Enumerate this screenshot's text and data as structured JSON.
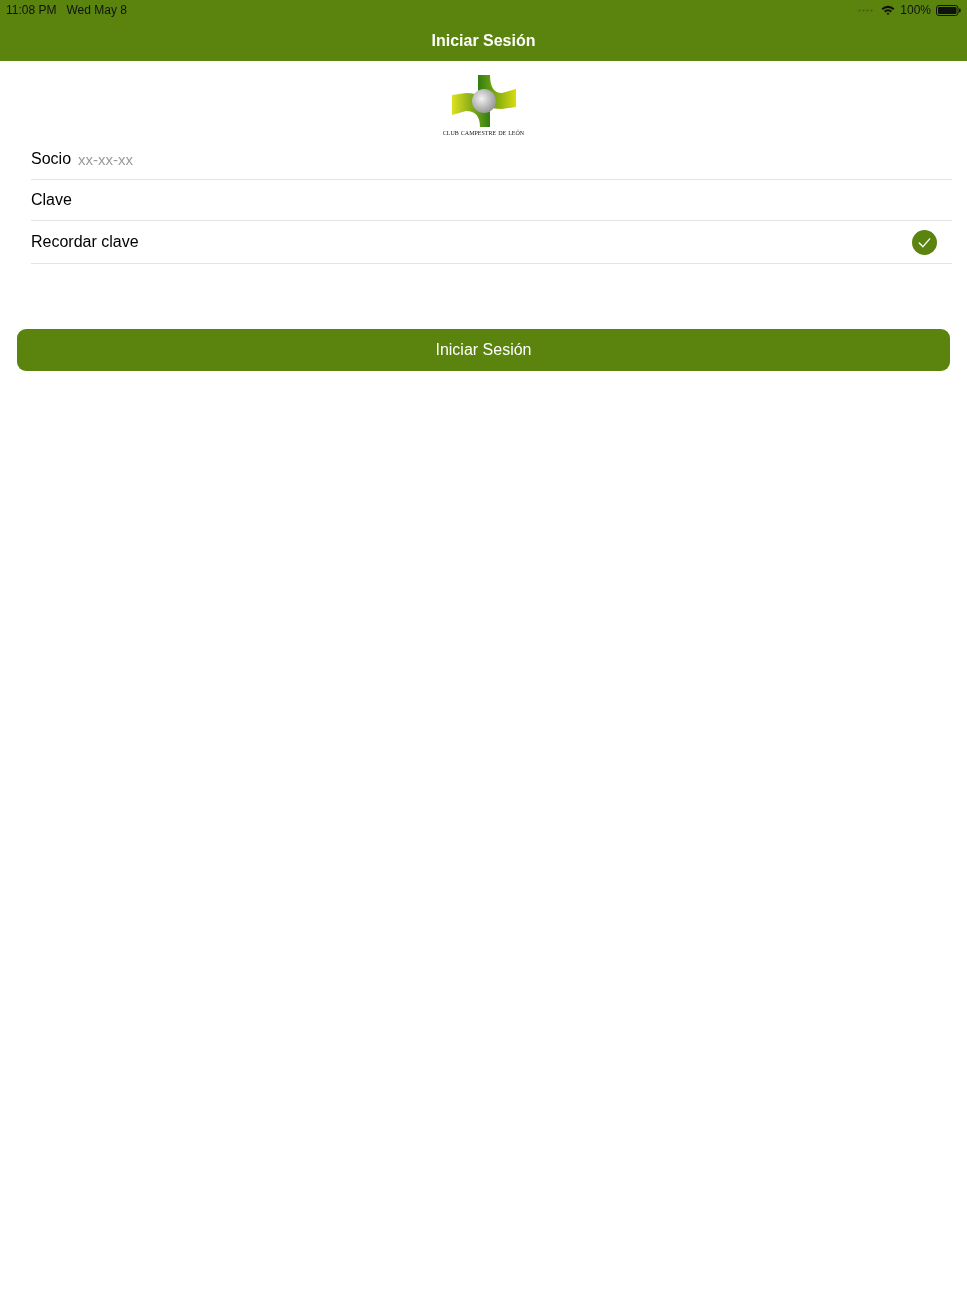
{
  "status_bar": {
    "time": "11:08 PM",
    "date": "Wed May 8",
    "battery": "100%"
  },
  "nav_bar": {
    "title": "Iniciar Sesión"
  },
  "logo": {
    "caption": "club campestre de león"
  },
  "form": {
    "fields": [
      {
        "kind": "text",
        "label": "Socio",
        "placeholder": "xx-xx-xx"
      },
      {
        "kind": "password",
        "label": "Clave"
      },
      {
        "kind": "toggle",
        "label": "Recordar clave",
        "checked": true
      }
    ]
  },
  "button": {
    "label": "Iniciar Sesión"
  }
}
